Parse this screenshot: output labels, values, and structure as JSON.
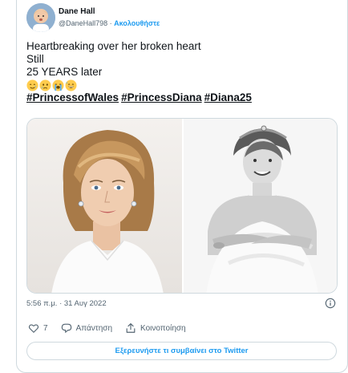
{
  "author": {
    "name": "Dane Hall",
    "handle": "@DaneHall798",
    "separator": " · ",
    "follow_label": "Ακολουθήστε"
  },
  "tweet": {
    "lines": [
      "Heartbreaking over her broken heart",
      "Still",
      "25 YEARS later"
    ],
    "emojis": [
      "smiling-with-tear-emoji",
      "crying-face-emoji",
      "loudly-crying-face-emoji",
      "grinning-sweat-emoji"
    ],
    "hashtags": [
      "#PrincessofWales",
      "#PrincessDiana",
      "#Diana25"
    ]
  },
  "media": {
    "left_image": "color-portrait",
    "right_image": "black-and-white-portrait"
  },
  "meta": {
    "timestamp": "5:56 π.μ. · 31 Αυγ 2022"
  },
  "actions": {
    "like_count": "7",
    "reply_label": "Απάντηση",
    "share_label": "Κοινοποίηση"
  },
  "explore_label": "Εξερευνήστε τι συμβαίνει στο Twitter",
  "colors": {
    "accent": "#1d9bf0",
    "text": "#0f1419",
    "muted": "#536471",
    "border": "#cfd9de"
  }
}
